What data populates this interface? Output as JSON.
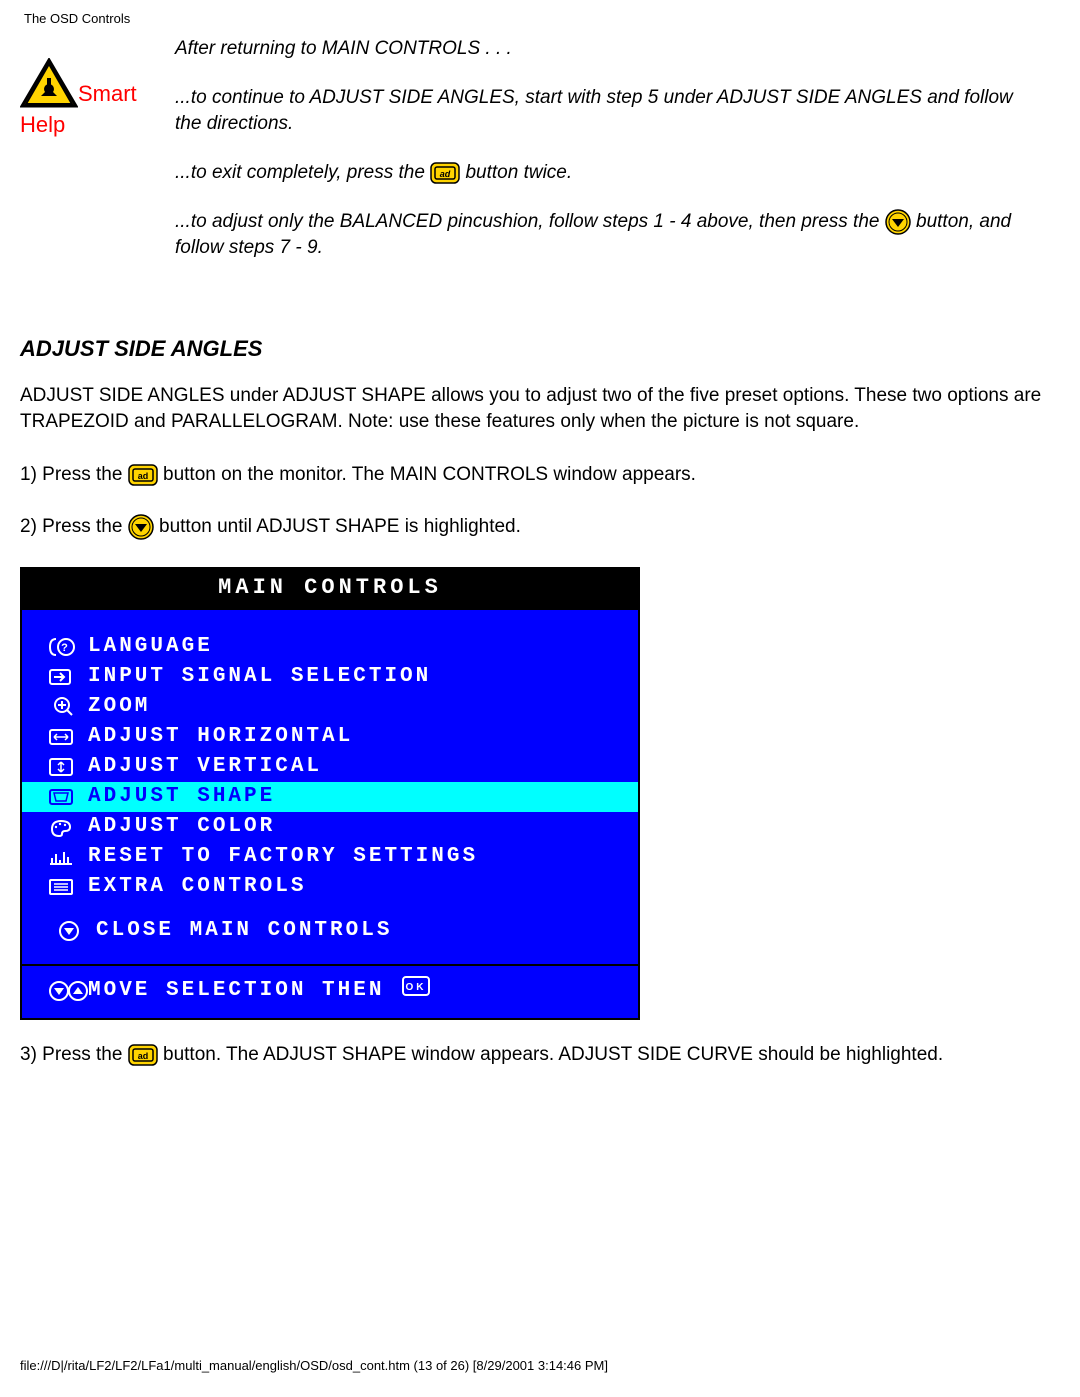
{
  "header": "The OSD Controls",
  "smartHelpLabel": {
    "smart": "Smart",
    "help": "Help"
  },
  "smartHelp": {
    "line1": "After returning to MAIN CONTROLS . . .",
    "line2": "...to continue to ADJUST SIDE ANGLES, start with step 5 under ADJUST SIDE ANGLES and follow the directions.",
    "line3a": "...to exit completely, press the ",
    "line3b": " button twice.",
    "line4a": "...to adjust only the BALANCED pincushion, follow steps 1 - 4 above, then press the ",
    "line4b": " button, and follow steps 7 - 9."
  },
  "sectionTitle": "ADJUST SIDE ANGLES",
  "intro": "ADJUST SIDE ANGLES under ADJUST SHAPE allows you to adjust two of the five preset options. These two options are TRAPEZOID and PARALLELOGRAM. Note: use these features only when the picture is not square.",
  "step1a": "1) Press the ",
  "step1b": " button on the monitor. The MAIN CONTROLS window appears.",
  "step2a": "2) Press the ",
  "step2b": " button until ADJUST SHAPE is highlighted.",
  "step3a": "3) Press the ",
  "step3b": " button. The ADJUST SHAPE window appears. ADJUST SIDE CURVE should be highlighted.",
  "osd": {
    "title": "MAIN CONTROLS",
    "items": [
      "LANGUAGE",
      "INPUT SIGNAL SELECTION",
      "ZOOM",
      "ADJUST HORIZONTAL",
      "ADJUST VERTICAL",
      "ADJUST SHAPE",
      "ADJUST COLOR",
      "RESET TO FACTORY SETTINGS",
      "EXTRA CONTROLS"
    ],
    "close": "CLOSE MAIN CONTROLS",
    "footer": "MOVE SELECTION THEN"
  },
  "footerPath": "file:///D|/rita/LF2/LF2/LFa1/multi_manual/english/OSD/osd_cont.htm (13 of 26) [8/29/2001 3:14:46 PM]"
}
